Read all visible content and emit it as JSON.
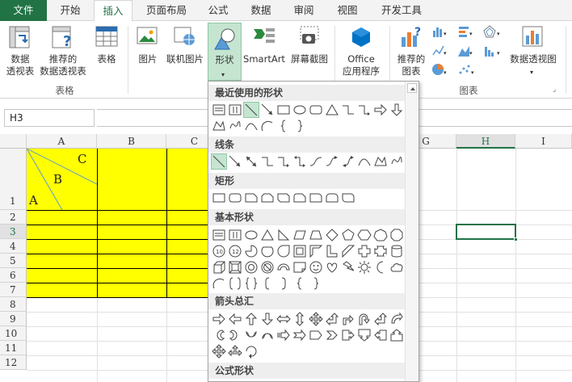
{
  "tabs": [
    {
      "label": "文件",
      "key": "file"
    },
    {
      "label": "开始",
      "key": "home"
    },
    {
      "label": "插入",
      "key": "insert",
      "active": true
    },
    {
      "label": "页面布局",
      "key": "layout"
    },
    {
      "label": "公式",
      "key": "formulas"
    },
    {
      "label": "数据",
      "key": "data"
    },
    {
      "label": "审阅",
      "key": "review"
    },
    {
      "label": "视图",
      "key": "view"
    },
    {
      "label": "开发工具",
      "key": "developer"
    }
  ],
  "ribbon": {
    "pivot_table": "数据透视表",
    "pivot_table_l1": "数据",
    "pivot_table_l2": "透视表",
    "recommended_pivot_l1": "推荐的",
    "recommended_pivot_l2": "数据透视表",
    "table": "表格",
    "tables_group": "表格",
    "picture": "图片",
    "online_picture": "联机图片",
    "shapes": "形状",
    "smartart": "SmartArt",
    "screenshot": "屏幕截图",
    "office_apps_l1": "Office",
    "office_apps_l2": "应用程序",
    "recommended_charts_l1": "推荐的",
    "recommended_charts_l2": "图表",
    "pivot_chart": "数据透视图",
    "charts_group": "图表"
  },
  "formula_bar": {
    "name_box": "H3"
  },
  "sheet": {
    "columns": [
      "A",
      "B",
      "C",
      "G",
      "H",
      "I"
    ],
    "rows": [
      "1",
      "2",
      "3",
      "4",
      "5",
      "6",
      "7",
      "8",
      "9",
      "10",
      "11",
      "12"
    ],
    "selected_cell": "H3",
    "diagonal_labels": {
      "a": "A",
      "b": "B",
      "c": "C"
    },
    "fill_color": "#ffff00"
  },
  "shapes_menu": {
    "categories": [
      "最近使用的形状",
      "线条",
      "矩形",
      "基本形状",
      "箭头总汇",
      "公式形状"
    ]
  },
  "colors": {
    "accent": "#217346",
    "highlight": "#c5e5d1"
  }
}
